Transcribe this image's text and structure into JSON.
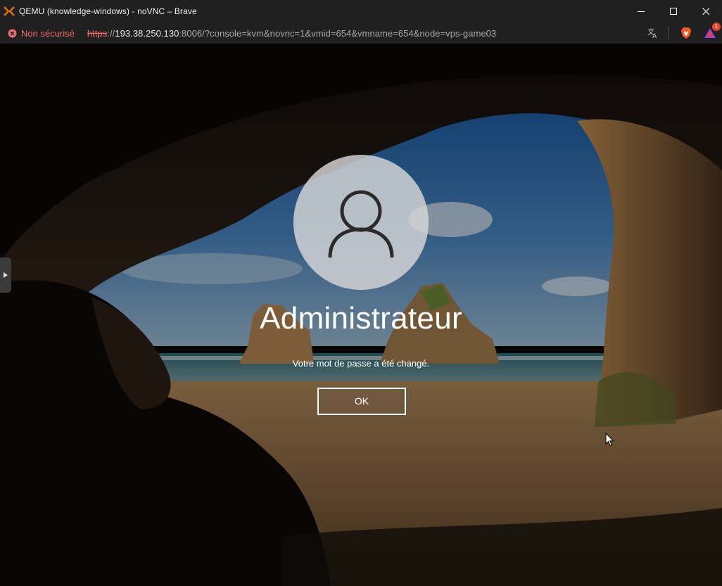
{
  "window": {
    "title": "QEMU (knowledge-windows) - noVNC – Brave",
    "app_icon": "proxmox-x-icon",
    "controls": [
      "minimize",
      "maximize",
      "close"
    ]
  },
  "addressbar": {
    "security_label": "Non sécurisé",
    "url_scheme": "https",
    "url_sep": "://",
    "url_host": "193.38.250.130",
    "url_rest": ":8006/?console=kvm&novnc=1&vmid=654&vmname=654&node=vps-game03",
    "rewards_count": "1",
    "icons": [
      "translate-icon",
      "brave-shields-icon",
      "brave-rewards-icon"
    ]
  },
  "login": {
    "username": "Administrateur",
    "message": "Votre mot de passe a été changé.",
    "ok_label": "OK"
  },
  "colors": {
    "chrome": "#202020",
    "insecure": "#ef6c6c",
    "brand_orange": "#e57000"
  }
}
